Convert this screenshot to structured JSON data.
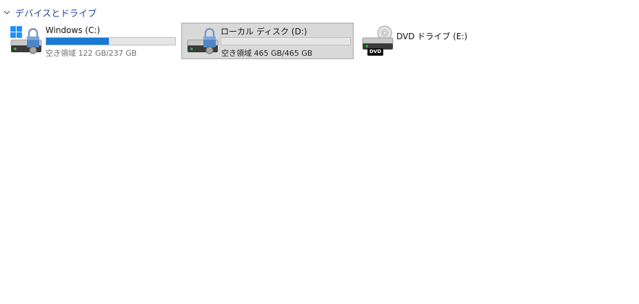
{
  "section": {
    "title": "デバイスとドライブ"
  },
  "drives": [
    {
      "name": "Windows (C:)",
      "free_text": "空き領域 122 GB/237 GB",
      "used_fraction": 0.485
    },
    {
      "name": "ローカル ディスク (D:)",
      "free_text": "空き領域 465 GB/465 GB",
      "used_fraction": 0.0
    },
    {
      "name": "DVD ドライブ (E:)",
      "badge": "DVD"
    }
  ],
  "colors": {
    "accent": "#1a7ad3",
    "selection": "#d9d9d9",
    "header": "#1f3f8f"
  }
}
